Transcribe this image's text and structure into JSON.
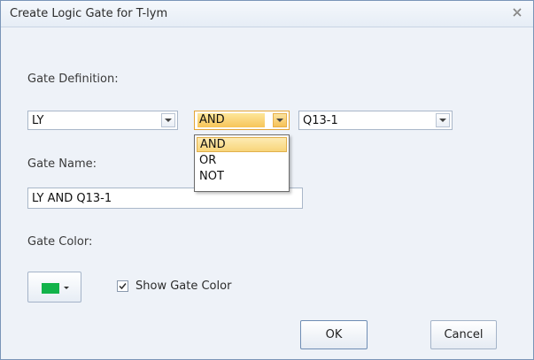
{
  "window": {
    "title": "Create Logic Gate for T-lym"
  },
  "definition": {
    "label": "Gate Definition:",
    "left_value": "LY",
    "operator_value": "AND",
    "right_value": "Q13-1",
    "operator_options": [
      "AND",
      "OR",
      "NOT"
    ],
    "selected_option": "AND"
  },
  "name": {
    "label": "Gate Name:",
    "value": "LY AND Q13-1"
  },
  "color": {
    "label": "Gate Color:",
    "swatch": "#12b34a",
    "show_label": "Show Gate Color",
    "show_checked": true
  },
  "buttons": {
    "ok": "OK",
    "cancel": "Cancel"
  }
}
